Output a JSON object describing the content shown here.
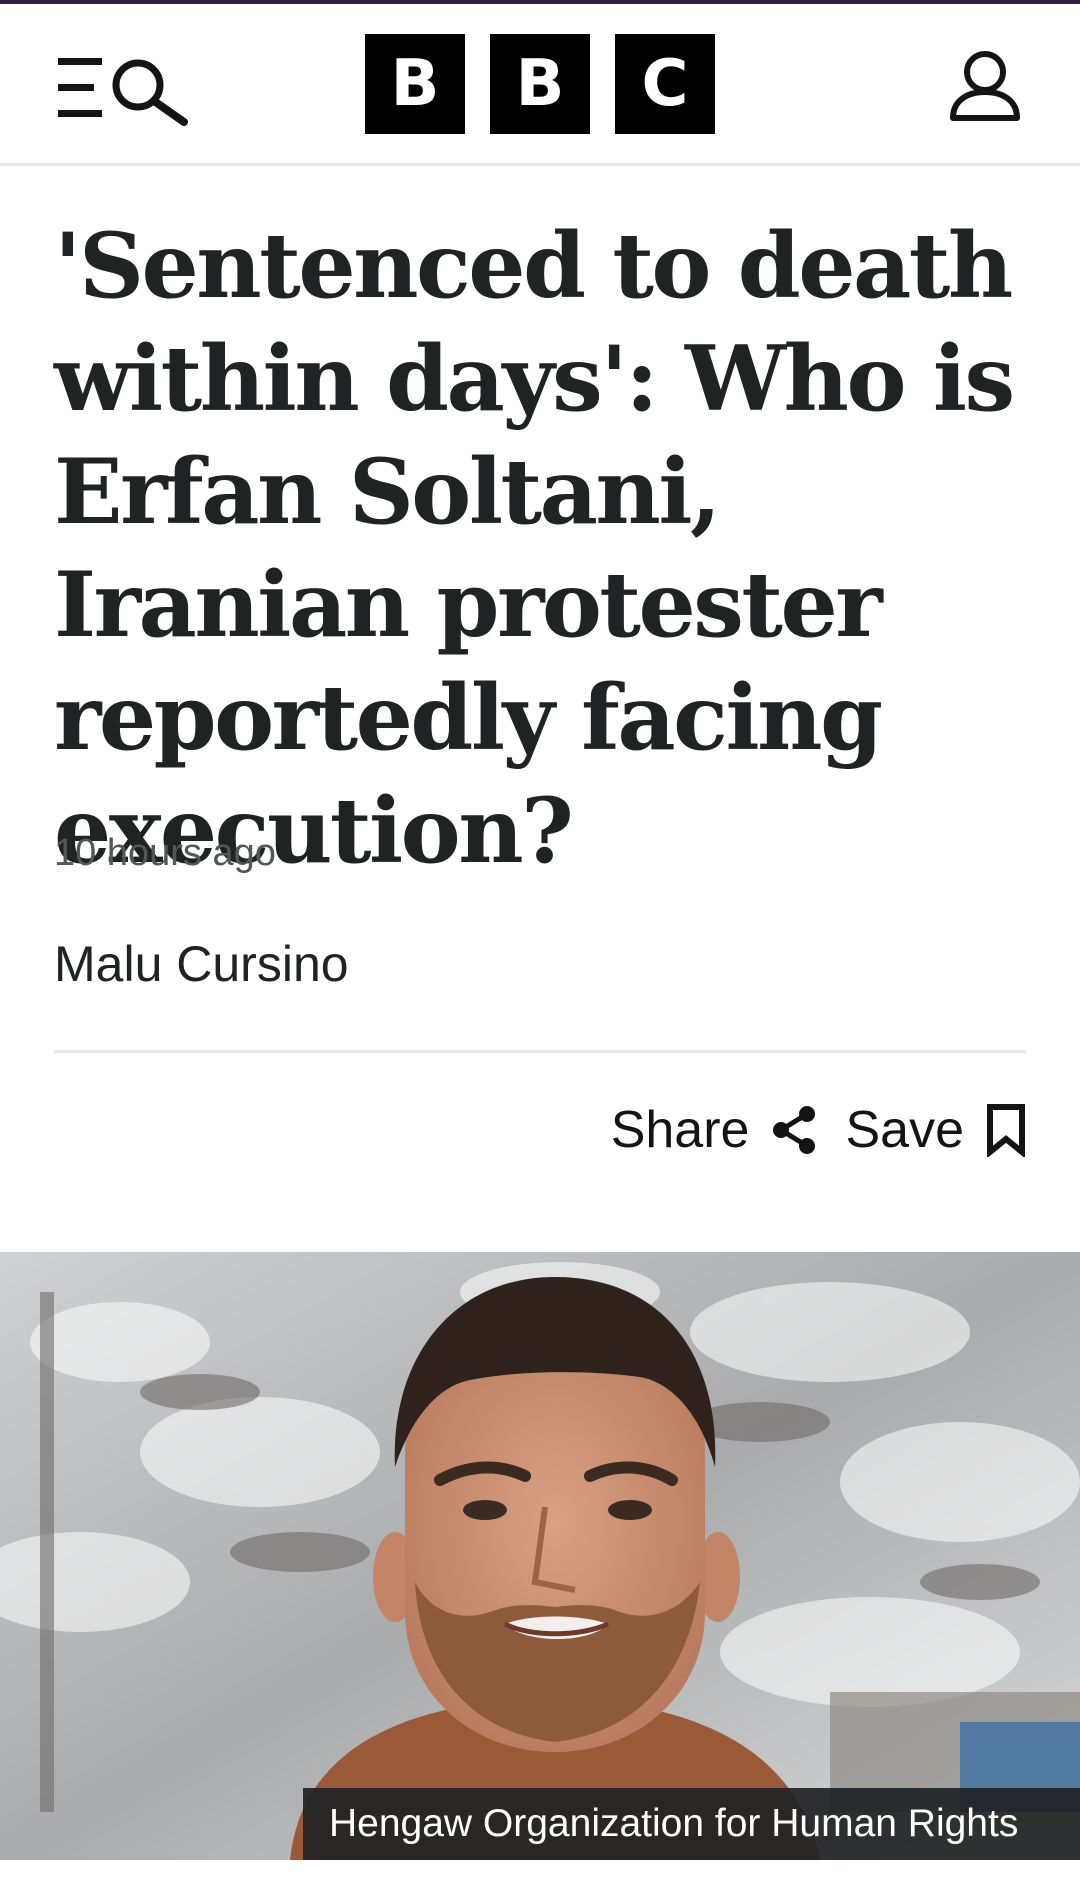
{
  "header": {
    "logo_letters": [
      "B",
      "B",
      "C"
    ],
    "menu_icon": "menu-icon",
    "search_icon": "search-icon",
    "account_icon": "account-icon"
  },
  "article": {
    "headline": "'Sentenced to death within days': Who is Erfan Soltani, Iranian protester reportedly facing execution?",
    "timestamp": "10 hours ago",
    "author": "Malu Cursino",
    "share_label": "Share",
    "save_label": "Save",
    "share_icon": "share-icon",
    "save_icon": "bookmark-icon"
  },
  "image": {
    "caption": "Hengaw Organization for Human Rights"
  },
  "colors": {
    "text": "#202224",
    "secondary_text": "#545658",
    "divider": "#e6e8ea",
    "logo_block": "#000000",
    "caption_bg": "#202224"
  }
}
